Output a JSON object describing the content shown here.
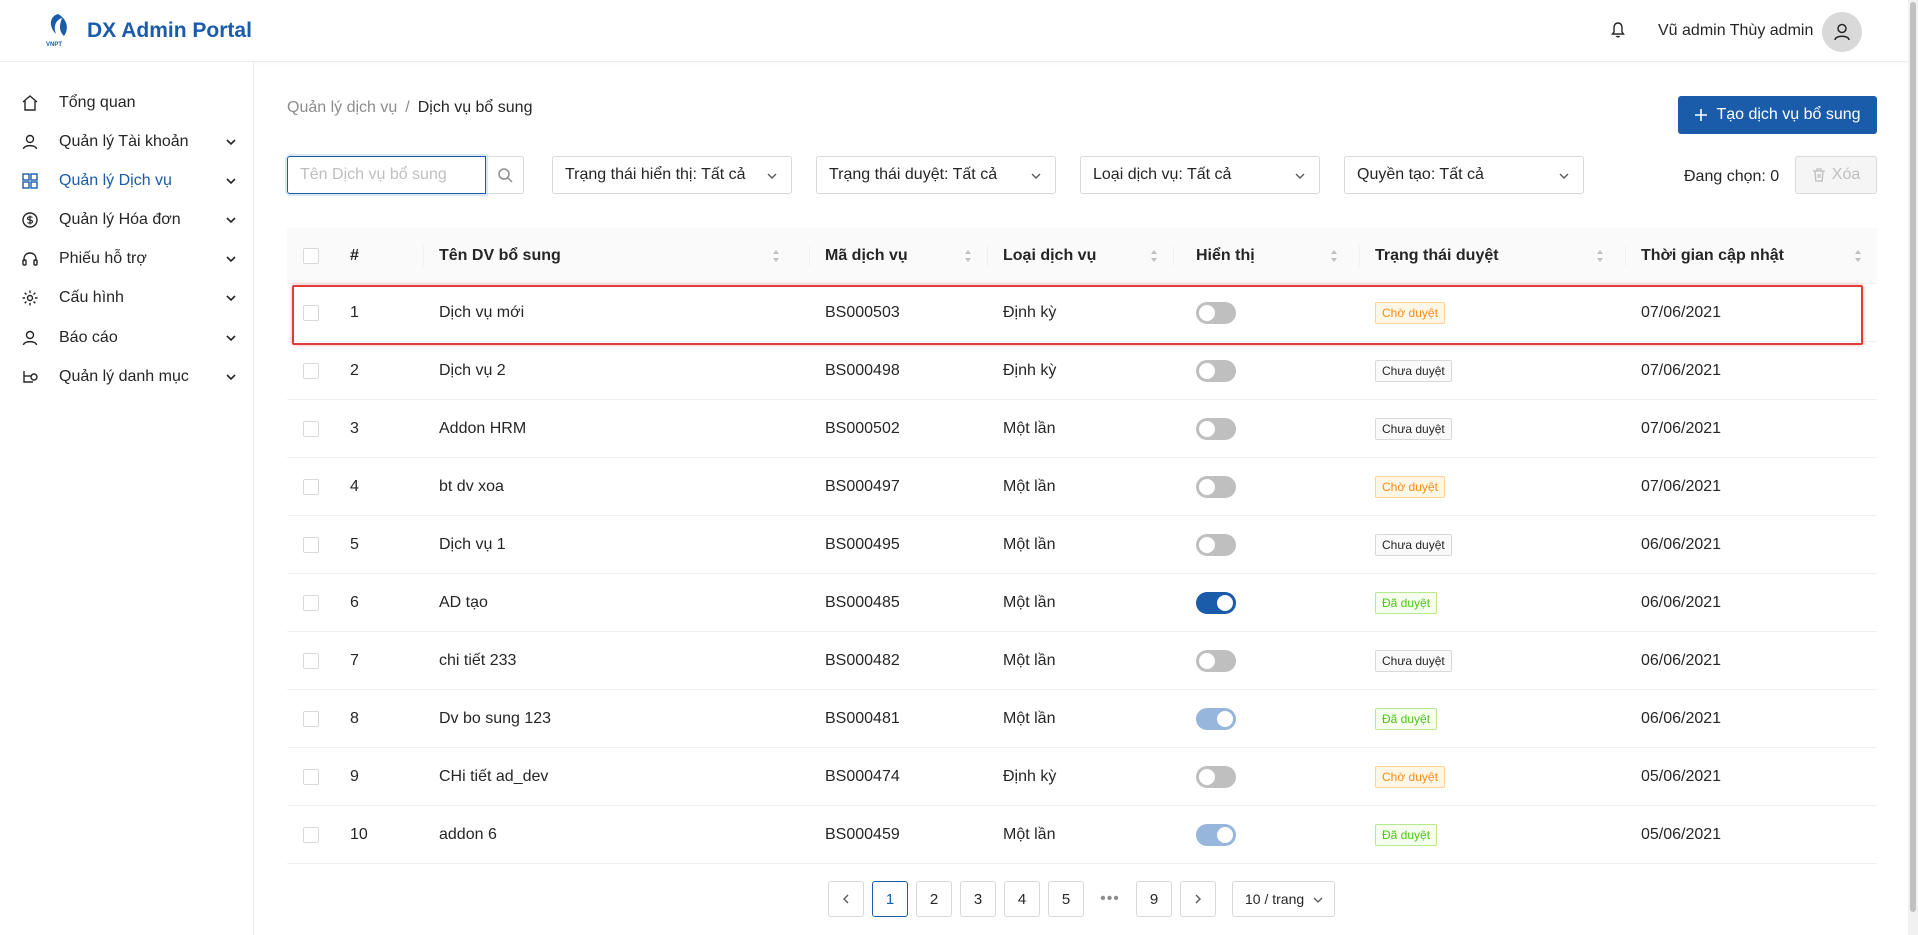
{
  "app": {
    "brand": "DX Admin Portal",
    "logo_text": "VNPT"
  },
  "header": {
    "user_name": "Vũ admin Thùy admin"
  },
  "sidebar": {
    "items": [
      {
        "label": "Tổng quan",
        "icon": "home-icon",
        "expandable": false
      },
      {
        "label": "Quản lý Tài khoản",
        "icon": "user-icon",
        "expandable": true
      },
      {
        "label": "Quản lý Dịch vụ",
        "icon": "grid-icon",
        "expandable": true,
        "active": true
      },
      {
        "label": "Quản lý Hóa đơn",
        "icon": "dollar-icon",
        "expandable": true
      },
      {
        "label": "Phiếu hỗ trợ",
        "icon": "headset-icon",
        "expandable": true
      },
      {
        "label": "Cấu hình",
        "icon": "gear-icon",
        "expandable": true
      },
      {
        "label": "Báo cáo",
        "icon": "user-icon",
        "expandable": true
      },
      {
        "label": "Quản lý danh mục",
        "icon": "category-icon",
        "expandable": true
      }
    ]
  },
  "breadcrumb": {
    "parent": "Quản lý dịch vụ",
    "separator": "/",
    "current": "Dịch vụ bổ sung"
  },
  "toolbar": {
    "create_label": "Tạo dịch vụ bổ sung",
    "search_placeholder": "Tên Dịch vụ bổ sung",
    "filters": [
      "Trạng thái hiển thị: Tất cả",
      "Trạng thái duyệt: Tất cả",
      "Loại dịch vụ: Tất cả",
      "Quyền tạo: Tất cả"
    ],
    "selected_label": "Đang chọn: 0",
    "delete_label": "Xóa"
  },
  "table": {
    "columns": [
      "#",
      "Tên DV bổ sung",
      "Mã dịch vụ",
      "Loại dịch vụ",
      "Hiển thị",
      "Trạng thái duyệt",
      "Thời gian cập nhật"
    ],
    "rows": [
      {
        "no": "1",
        "name": "Dịch vụ mới",
        "code": "BS000503",
        "type": "Định kỳ",
        "visible": "off",
        "status": "Chờ duyệt",
        "status_kind": "wait",
        "updated": "07/06/2021"
      },
      {
        "no": "2",
        "name": "Dịch vụ 2",
        "code": "BS000498",
        "type": "Định kỳ",
        "visible": "off",
        "status": "Chưa duyệt",
        "status_kind": "none",
        "updated": "07/06/2021"
      },
      {
        "no": "3",
        "name": "Addon HRM",
        "code": "BS000502",
        "type": "Một lần",
        "visible": "off",
        "status": "Chưa duyệt",
        "status_kind": "none",
        "updated": "07/06/2021"
      },
      {
        "no": "4",
        "name": "bt dv xoa",
        "code": "BS000497",
        "type": "Một lần",
        "visible": "off",
        "status": "Chờ duyệt",
        "status_kind": "wait",
        "updated": "07/06/2021"
      },
      {
        "no": "5",
        "name": "Dịch vụ 1",
        "code": "BS000495",
        "type": "Một lần",
        "visible": "off",
        "status": "Chưa duyệt",
        "status_kind": "none",
        "updated": "06/06/2021"
      },
      {
        "no": "6",
        "name": "AD tạo",
        "code": "BS000485",
        "type": "Một lần",
        "visible": "on",
        "status": "Đã duyệt",
        "status_kind": "done",
        "updated": "06/06/2021"
      },
      {
        "no": "7",
        "name": "chi tiết 233",
        "code": "BS000482",
        "type": "Một lần",
        "visible": "off",
        "status": "Chưa duyệt",
        "status_kind": "none",
        "updated": "06/06/2021"
      },
      {
        "no": "8",
        "name": "Dv bo sung 123",
        "code": "BS000481",
        "type": "Một lần",
        "visible": "on-light",
        "status": "Đã duyệt",
        "status_kind": "done",
        "updated": "06/06/2021"
      },
      {
        "no": "9",
        "name": "CHi tiết ad_dev",
        "code": "BS000474",
        "type": "Định kỳ",
        "visible": "off",
        "status": "Chờ duyệt",
        "status_kind": "wait",
        "updated": "05/06/2021"
      },
      {
        "no": "10",
        "name": "addon 6",
        "code": "BS000459",
        "type": "Một lần",
        "visible": "on-light",
        "status": "Đã duyệt",
        "status_kind": "done",
        "updated": "05/06/2021"
      }
    ]
  },
  "pagination": {
    "pages": [
      "1",
      "2",
      "3",
      "4",
      "5",
      "9"
    ],
    "current": "1",
    "ellipsis": "•••",
    "page_size": "10 / trang"
  },
  "colors": {
    "primary": "#1a5baa",
    "highlight": "#e03c3c"
  }
}
